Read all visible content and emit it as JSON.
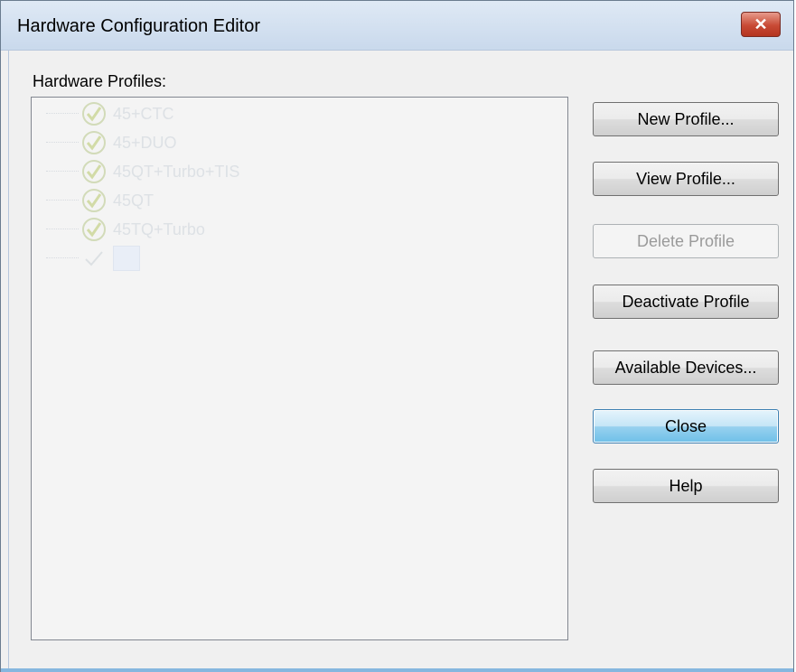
{
  "window": {
    "title": "Hardware Configuration Editor",
    "close_glyph": "✕"
  },
  "profiles": {
    "label": "Hardware Profiles:",
    "items": [
      {
        "label": "45+CTC",
        "icon": "check-circle-icon"
      },
      {
        "label": "45+DUO",
        "icon": "check-circle-icon"
      },
      {
        "label": "45QT+Turbo+TIS",
        "icon": "check-circle-icon"
      },
      {
        "label": "45QT",
        "icon": "check-circle-icon"
      },
      {
        "label": "45TQ+Turbo",
        "icon": "check-circle-icon"
      },
      {
        "label": "",
        "icon": "check-icon"
      }
    ]
  },
  "buttons": {
    "new_profile": "New Profile...",
    "view_profile": "View Profile...",
    "delete_profile": "Delete Profile",
    "deactivate_profile": "Deactivate Profile",
    "available_devices": "Available Devices...",
    "close": "Close",
    "help": "Help"
  },
  "colors": {
    "title_bar": "#c9d9ec",
    "close_button": "#c84a35",
    "default_button": "#98d1ef"
  }
}
